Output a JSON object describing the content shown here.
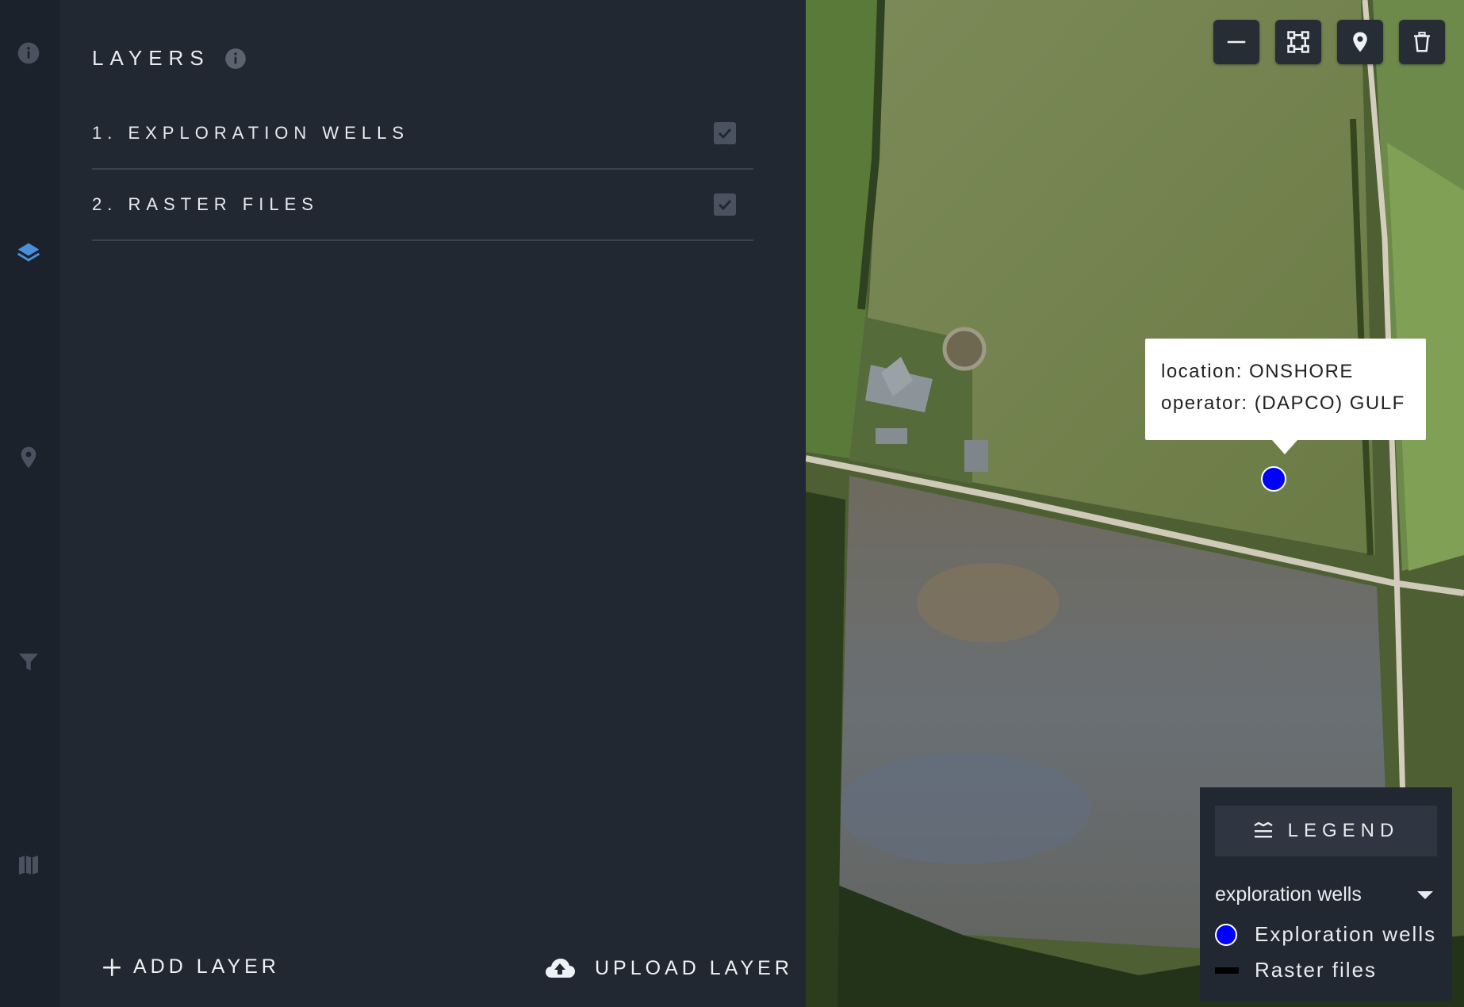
{
  "sidebar": {
    "icons": [
      {
        "name": "info-icon",
        "active": false
      },
      {
        "name": "layers-icon",
        "active": true
      },
      {
        "name": "map-marker-icon",
        "active": false
      },
      {
        "name": "filter-icon",
        "active": false
      },
      {
        "name": "map-icon",
        "active": false
      }
    ]
  },
  "layers_panel": {
    "title": "LAYERS",
    "layers": [
      {
        "label": "1. EXPLORATION WELLS",
        "checked": true
      },
      {
        "label": "2. RASTER FILES",
        "checked": true
      }
    ],
    "add_layer_label": "ADD LAYER",
    "upload_layer_label": "UPLOAD LAYER"
  },
  "map": {
    "toolbar": [
      "line-draw-icon",
      "polygon-draw-icon",
      "point-marker-icon",
      "trash-icon"
    ],
    "popup": {
      "line1": "location: ONSHORE",
      "line2": "operator: (DAPCO) GULF"
    },
    "point_color": "#0000ff"
  },
  "legend": {
    "header": "LEGEND",
    "selected_layer": "exploration wells",
    "items": [
      {
        "label": "Exploration wells",
        "symbol": "circle",
        "color": "#0000ff"
      },
      {
        "label": "Raster files",
        "symbol": "line",
        "color": "#000000"
      }
    ]
  },
  "colors": {
    "panel_bg": "#222831",
    "rail_bg": "#1c222b",
    "accent": "#4a90d9"
  }
}
